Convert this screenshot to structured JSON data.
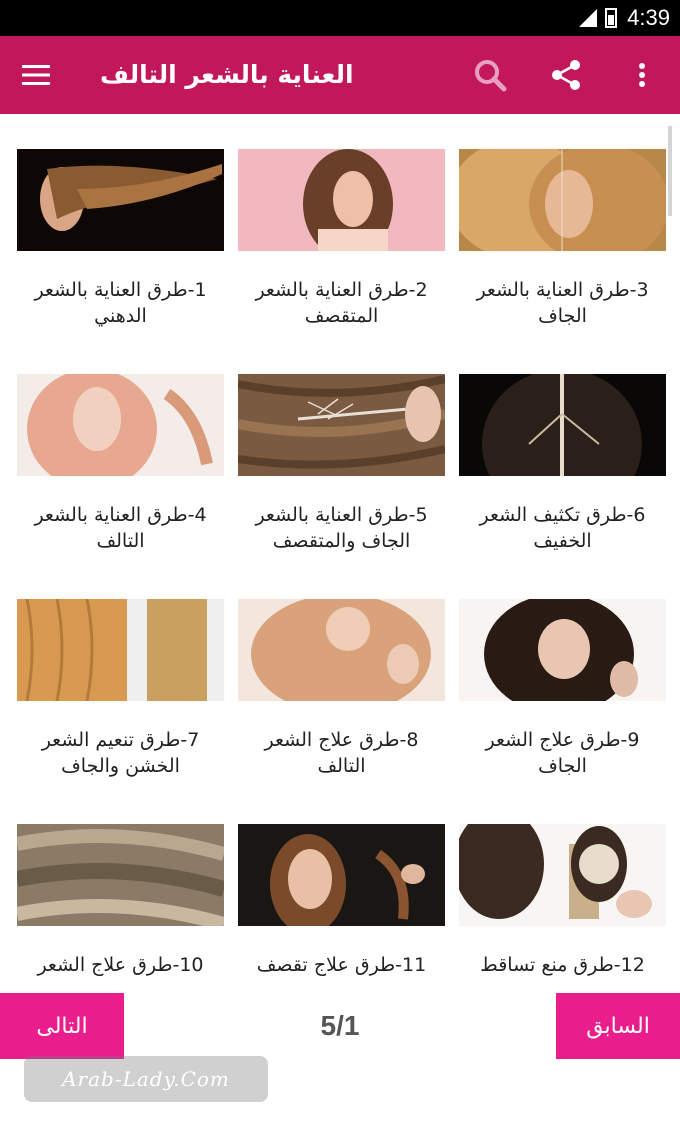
{
  "status_bar": {
    "time": "4:39",
    "network": "4G"
  },
  "app_bar": {
    "title": "العناية بالشعر التالف",
    "menu_icon": "menu-icon",
    "search_icon": "search-icon",
    "share_icon": "share-icon",
    "overflow_icon": "more-vert-icon",
    "color": "#c2185b"
  },
  "articles": [
    {
      "caption": "3-طرق العناية بالشعر الجاف"
    },
    {
      "caption": "2-طرق العناية بالشعر المتقصف"
    },
    {
      "caption": "1-طرق العناية بالشعر الدهني"
    },
    {
      "caption": "6-طرق تكثيف الشعر الخفيف"
    },
    {
      "caption": "5-طرق العناية بالشعر الجاف والمتقصف"
    },
    {
      "caption": "4-طرق العناية بالشعر التالف"
    },
    {
      "caption": "9-طرق علاج الشعر الجاف"
    },
    {
      "caption": "8-طرق علاج الشعر التالف"
    },
    {
      "caption": "7-طرق تنعيم الشعر الخشن والجاف"
    },
    {
      "caption": "12-طرق منع تساقط"
    },
    {
      "caption": "11-طرق علاج تقصف"
    },
    {
      "caption": "10-طرق علاج الشعر"
    }
  ],
  "pagination": {
    "prev_label": "السابق",
    "next_label": "التالى",
    "page": "5/1",
    "button_color": "#e91e8c"
  },
  "watermark": "Arab-Lady.Com"
}
